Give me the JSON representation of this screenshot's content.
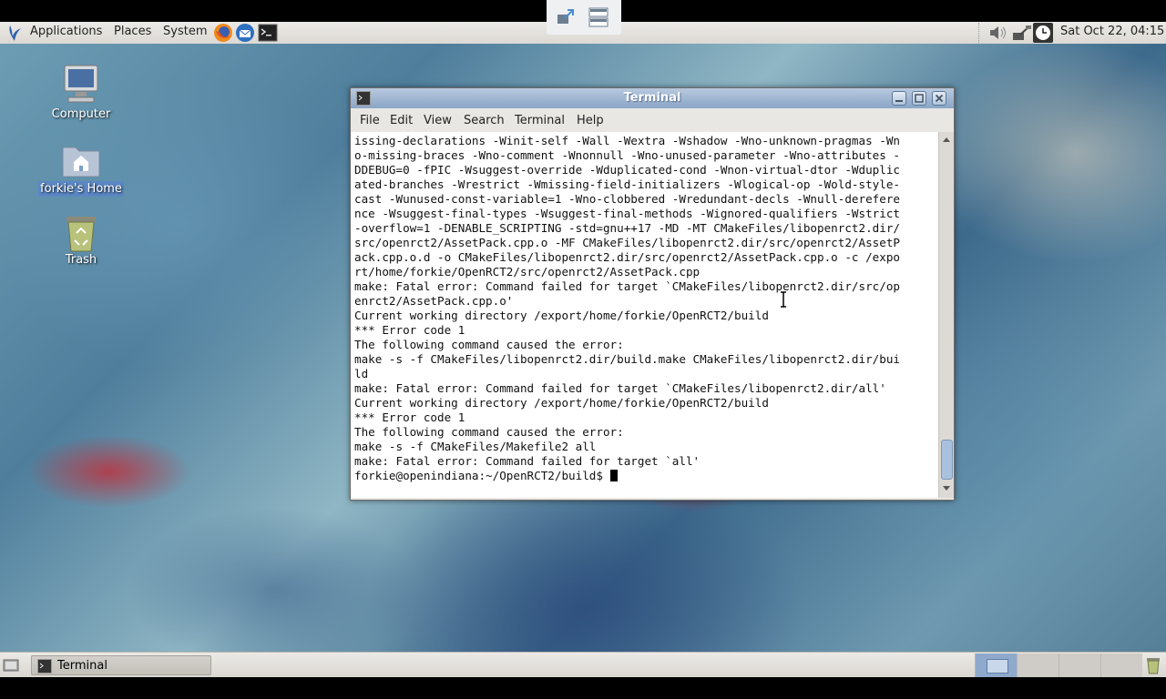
{
  "top_panel": {
    "menus": [
      "Applications",
      "Places",
      "System"
    ],
    "clock": "Sat Oct 22, 04:15"
  },
  "desktop_icons": [
    {
      "label": "Computer",
      "icon": "computer-icon"
    },
    {
      "label": "forkie's Home",
      "icon": "home-folder-icon"
    },
    {
      "label": "Trash",
      "icon": "trash-icon"
    }
  ],
  "terminal": {
    "title": "Terminal",
    "menus": [
      "File",
      "Edit",
      "View",
      "Search",
      "Terminal",
      "Help"
    ],
    "lines": [
      "issing-declarations -Winit-self -Wall -Wextra -Wshadow -Wno-unknown-pragmas -Wn",
      "o-missing-braces -Wno-comment -Wnonnull -Wno-unused-parameter -Wno-attributes -",
      "DDEBUG=0 -fPIC -Wsuggest-override -Wduplicated-cond -Wnon-virtual-dtor -Wduplic",
      "ated-branches -Wrestrict -Wmissing-field-initializers -Wlogical-op -Wold-style-",
      "cast -Wunused-const-variable=1 -Wno-clobbered -Wredundant-decls -Wnull-derefere",
      "nce -Wsuggest-final-types -Wsuggest-final-methods -Wignored-qualifiers -Wstrict",
      "-overflow=1 -DENABLE_SCRIPTING -std=gnu++17 -MD -MT CMakeFiles/libopenrct2.dir/",
      "src/openrct2/AssetPack.cpp.o -MF CMakeFiles/libopenrct2.dir/src/openrct2/AssetP",
      "ack.cpp.o.d -o CMakeFiles/libopenrct2.dir/src/openrct2/AssetPack.cpp.o -c /expo",
      "rt/home/forkie/OpenRCT2/src/openrct2/AssetPack.cpp",
      "make: Fatal error: Command failed for target `CMakeFiles/libopenrct2.dir/src/op",
      "enrct2/AssetPack.cpp.o'",
      "Current working directory /export/home/forkie/OpenRCT2/build",
      "*** Error code 1",
      "The following command caused the error:",
      "make -s -f CMakeFiles/libopenrct2.dir/build.make CMakeFiles/libopenrct2.dir/bui",
      "ld",
      "make: Fatal error: Command failed for target `CMakeFiles/libopenrct2.dir/all'",
      "Current working directory /export/home/forkie/OpenRCT2/build",
      "*** Error code 1",
      "The following command caused the error:",
      "make -s -f CMakeFiles/Makefile2 all",
      "make: Fatal error: Command failed for target `all'"
    ],
    "prompt": "forkie@openindiana:~/OpenRCT2/build$ "
  },
  "taskbar": {
    "task_label": "Terminal"
  }
}
